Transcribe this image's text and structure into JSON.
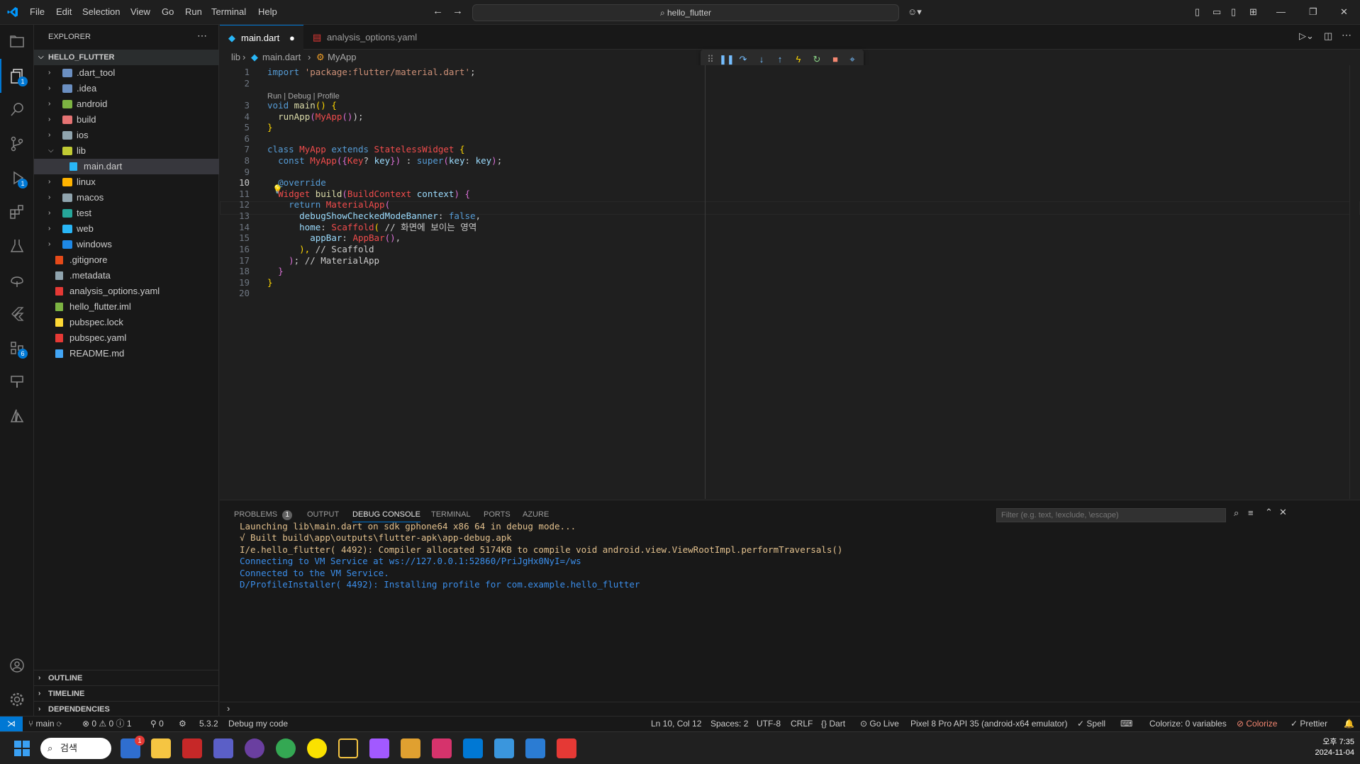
{
  "titlebar": {
    "menus": [
      "File",
      "Edit",
      "Selection",
      "View",
      "Go",
      "Run",
      "Terminal",
      "Help"
    ],
    "search": "hello_flutter"
  },
  "explorer": {
    "header": "EXPLORER",
    "root": "HELLO_FLUTTER",
    "items": [
      {
        "label": ".dart_tool",
        "type": "folder",
        "color": "#6b8fc1"
      },
      {
        "label": ".idea",
        "type": "folder",
        "color": "#6b8fc1"
      },
      {
        "label": "android",
        "type": "folder",
        "color": "#7cb342"
      },
      {
        "label": "build",
        "type": "folder",
        "color": "#e57373"
      },
      {
        "label": "ios",
        "type": "folder",
        "color": "#90a4ae"
      },
      {
        "label": "lib",
        "type": "folder-open",
        "color": "#c0ca33"
      },
      {
        "label": "main.dart",
        "type": "file",
        "color": "#29b6f6"
      },
      {
        "label": "linux",
        "type": "folder",
        "color": "#ffb300"
      },
      {
        "label": "macos",
        "type": "folder",
        "color": "#90a4ae"
      },
      {
        "label": "test",
        "type": "folder",
        "color": "#26a69a"
      },
      {
        "label": "web",
        "type": "folder",
        "color": "#29b6f6"
      },
      {
        "label": "windows",
        "type": "folder",
        "color": "#1e88e5"
      },
      {
        "label": ".gitignore",
        "type": "file",
        "color": "#e64a19"
      },
      {
        "label": ".metadata",
        "type": "file",
        "color": "#90a4ae"
      },
      {
        "label": "analysis_options.yaml",
        "type": "file",
        "color": "#e53935"
      },
      {
        "label": "hello_flutter.iml",
        "type": "file",
        "color": "#7cb342"
      },
      {
        "label": "pubspec.lock",
        "type": "file",
        "color": "#fdd835"
      },
      {
        "label": "pubspec.yaml",
        "type": "file",
        "color": "#e53935"
      },
      {
        "label": "README.md",
        "type": "file",
        "color": "#42a5f5"
      }
    ],
    "sections": [
      "OUTLINE",
      "TIMELINE",
      "DEPENDENCIES"
    ]
  },
  "tabs": [
    {
      "label": "main.dart",
      "active": true,
      "dirty": true
    },
    {
      "label": "analysis_options.yaml",
      "active": false
    }
  ],
  "breadcrumb": [
    "lib",
    "main.dart",
    "MyApp"
  ],
  "codelens": "Run | Debug | Profile",
  "panel": {
    "tabs": [
      {
        "label": "PROBLEMS",
        "badge": "1"
      },
      {
        "label": "OUTPUT"
      },
      {
        "label": "DEBUG CONSOLE",
        "active": true
      },
      {
        "label": "TERMINAL"
      },
      {
        "label": "PORTS"
      },
      {
        "label": "AZURE"
      }
    ],
    "filter_placeholder": "Filter (e.g. text, !exclude, \\escape)",
    "console": [
      {
        "text": "Launching lib\\main.dart on sdk gphone64 x86 64 in debug mode...",
        "color": "#e2c08d"
      },
      {
        "text": "√ Built build\\app\\outputs\\flutter-apk\\app-debug.apk",
        "color": "#e2c08d"
      },
      {
        "text": "I/e.hello_flutter( 4492): Compiler allocated 5174KB to compile void android.view.ViewRootImpl.performTraversals()",
        "color": "#e2c08d"
      },
      {
        "text": "Connecting to VM Service at ws://127.0.0.1:52860/PriJgHx0NyI=/ws",
        "color": "#3b8eea"
      },
      {
        "text": "Connected to the VM Service.",
        "color": "#3b8eea"
      },
      {
        "text": "D/ProfileInstaller( 4492): Installing profile for com.example.hello_flutter",
        "color": "#3b8eea"
      }
    ]
  },
  "statusbar": {
    "branch": "main",
    "errors": "0",
    "warnings": "0",
    "info": "1",
    "ports": "0",
    "flutter_version": "5.3.2",
    "debug_mode": "Debug my code",
    "position": "Ln 10, Col 12",
    "spaces": "Spaces: 2",
    "encoding": "UTF-8",
    "eol": "CRLF",
    "language": "Dart",
    "golive": "Go Live",
    "device": "Pixel 8 Pro API 35 (android-x64 emulator)",
    "spell": "Spell",
    "colorize_vars": "Colorize: 0 variables",
    "colorize": "Colorize",
    "prettier": "Prettier"
  },
  "taskbar": {
    "search": "검색",
    "time": "오후 7:35",
    "date": "2024-11-04",
    "badge": "1"
  },
  "activity_badges": {
    "explorer": "1",
    "debug": "1",
    "remote": "6"
  }
}
